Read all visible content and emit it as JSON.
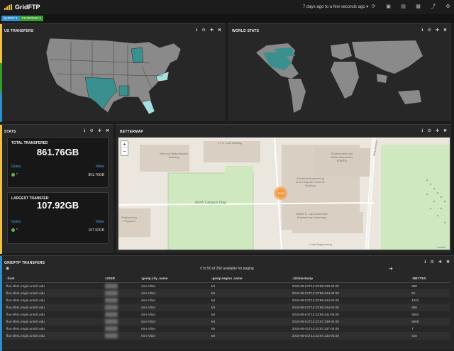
{
  "app": {
    "title": "GridFTP",
    "timerange": "7 days ago to a few seconds ago"
  },
  "topbar": {
    "icons": [
      "refresh-icon",
      "new-dashboard-icon",
      "open-folder-icon",
      "save-icon",
      "share-icon",
      "settings-icon"
    ]
  },
  "filterbar": {
    "query_label": "QUERY",
    "filter_label": "FILTERING"
  },
  "panels": {
    "us_transfers": {
      "title": "US TRANSFERS"
    },
    "world_stats": {
      "title": "WORLD STATS"
    },
    "stats": {
      "title": "STATS"
    },
    "bettermap": {
      "title": "BETTERMAP"
    },
    "gridftp_transfers": {
      "title": "GRIDFTP TRANSFERS"
    }
  },
  "stats": {
    "total": {
      "label": "TOTAL TRANSFERED",
      "value": "861.76GB",
      "query_header": "Query",
      "value_header": "Value",
      "row_query": "*",
      "row_value": "861.76GB"
    },
    "largest": {
      "label": "LARGEST TRANSFER",
      "value": "107.92GB",
      "query_header": "Query",
      "value_header": "Value",
      "row_query": "*",
      "row_value": "107.92GB"
    }
  },
  "bettermap": {
    "zoom_in": "+",
    "zoom_out": "−",
    "cluster_count": "1003",
    "labels": {
      "bob": "Bob and Betty Beyster Building",
      "hh": "H. H. Dow Building",
      "env": "Environment and Water Resources (EWRE)",
      "eecs": "Electrical Engineering and Computer Science Building",
      "diag": "North Campus Diag",
      "walter": "Walter E. Lay Automotive Engineering Laboratory",
      "lurie": "Lurie Engineering",
      "engineer": "Engineering Programs",
      "road": "Beal Avenue",
      "attribution": "Leaflet"
    }
  },
  "table": {
    "pager": "0 to 50 of 250 available for paging",
    "columns": [
      "host",
      "USER",
      "geoip.city_name",
      "geoip.region_name",
      "@timestamp",
      "NBYTES"
    ],
    "rows": [
      [
        "flux-xfer1.engin.umich.edu",
        "",
        "Ann Arbor",
        "MI",
        "2015-06-01T14:23:58.248-04:00",
        "288"
      ],
      [
        "flux-xfer1.engin.umich.edu",
        "",
        "Ann Arbor",
        "MI",
        "2015-06-01T14:23:58.244-04:00",
        "91"
      ],
      [
        "flux-xfer1.engin.umich.edu",
        "",
        "Ann Arbor",
        "MI",
        "2015-06-01T14:23:58.244-04:00",
        "1022"
      ],
      [
        "flux-xfer1.engin.umich.edu",
        "",
        "Ann Arbor",
        "MI",
        "2015-06-01T14:23:58.244-04:00",
        "606"
      ],
      [
        "flux-xfer1.engin.umich.edu",
        "",
        "Ann Arbor",
        "MI",
        "2015-06-01T14:23:58.241-04:00",
        "4004"
      ],
      [
        "flux-xfer1.engin.umich.edu",
        "",
        "Ann Arbor",
        "MI",
        "2015-06-01T14:23:57.239-04:00",
        "6608"
      ],
      [
        "flux-xfer1.engin.umich.edu",
        "",
        "Ann Arbor",
        "MI",
        "2015-06-01T14:23:57.237-04:00",
        "7"
      ],
      [
        "flux-xfer1.engin.umich.edu",
        "",
        "Ann Arbor",
        "MI",
        "2015-06-01T14:23:57.234-04:00",
        "616"
      ]
    ]
  },
  "colors": {
    "accent_yellow": "#f0c040",
    "accent_green": "#3a9a32",
    "accent_blue": "#2f8fc9",
    "map_highlight": "#3a8f8f",
    "cluster": "#f39a3f"
  }
}
